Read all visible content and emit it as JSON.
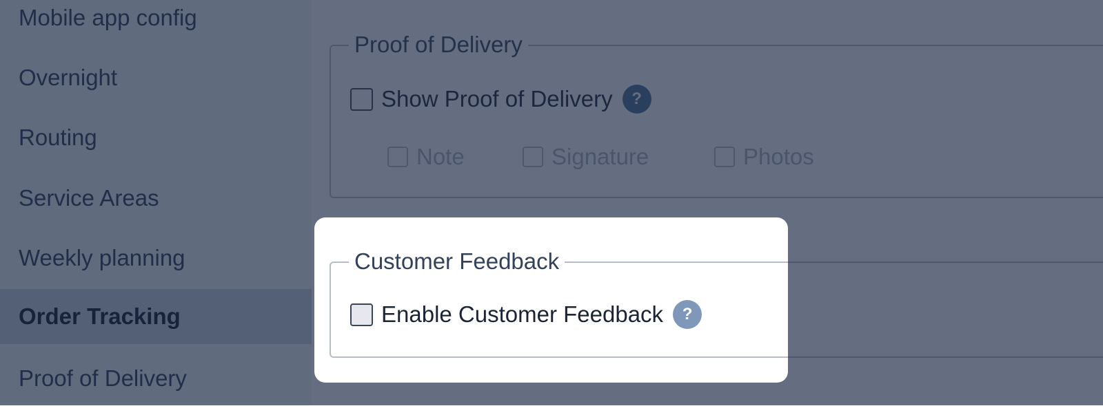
{
  "sidebar": {
    "items": [
      {
        "label": "Mobile app config"
      },
      {
        "label": "Overnight"
      },
      {
        "label": "Routing"
      },
      {
        "label": "Service Areas"
      },
      {
        "label": "Weekly planning"
      },
      {
        "label": "Order Tracking",
        "active": true
      },
      {
        "label": "Proof of Delivery"
      }
    ]
  },
  "proof_of_delivery": {
    "legend": "Proof of Delivery",
    "show_label": "Show Proof of Delivery",
    "show_checked": false,
    "help_icon": "question-circle-icon",
    "options": [
      {
        "label": "Note",
        "checked": false,
        "disabled": true
      },
      {
        "label": "Signature",
        "checked": false,
        "disabled": true
      },
      {
        "label": "Photos",
        "checked": false,
        "disabled": true
      }
    ]
  },
  "customer_feedback": {
    "legend": "Customer Feedback",
    "enable_label": "Enable Customer Feedback",
    "enable_checked": false,
    "help_icon": "question-circle-icon"
  },
  "colors": {
    "overlay": "#1c2a44",
    "active_sidebar": "#cbd2dd",
    "help_icon": "#7f98b9"
  }
}
